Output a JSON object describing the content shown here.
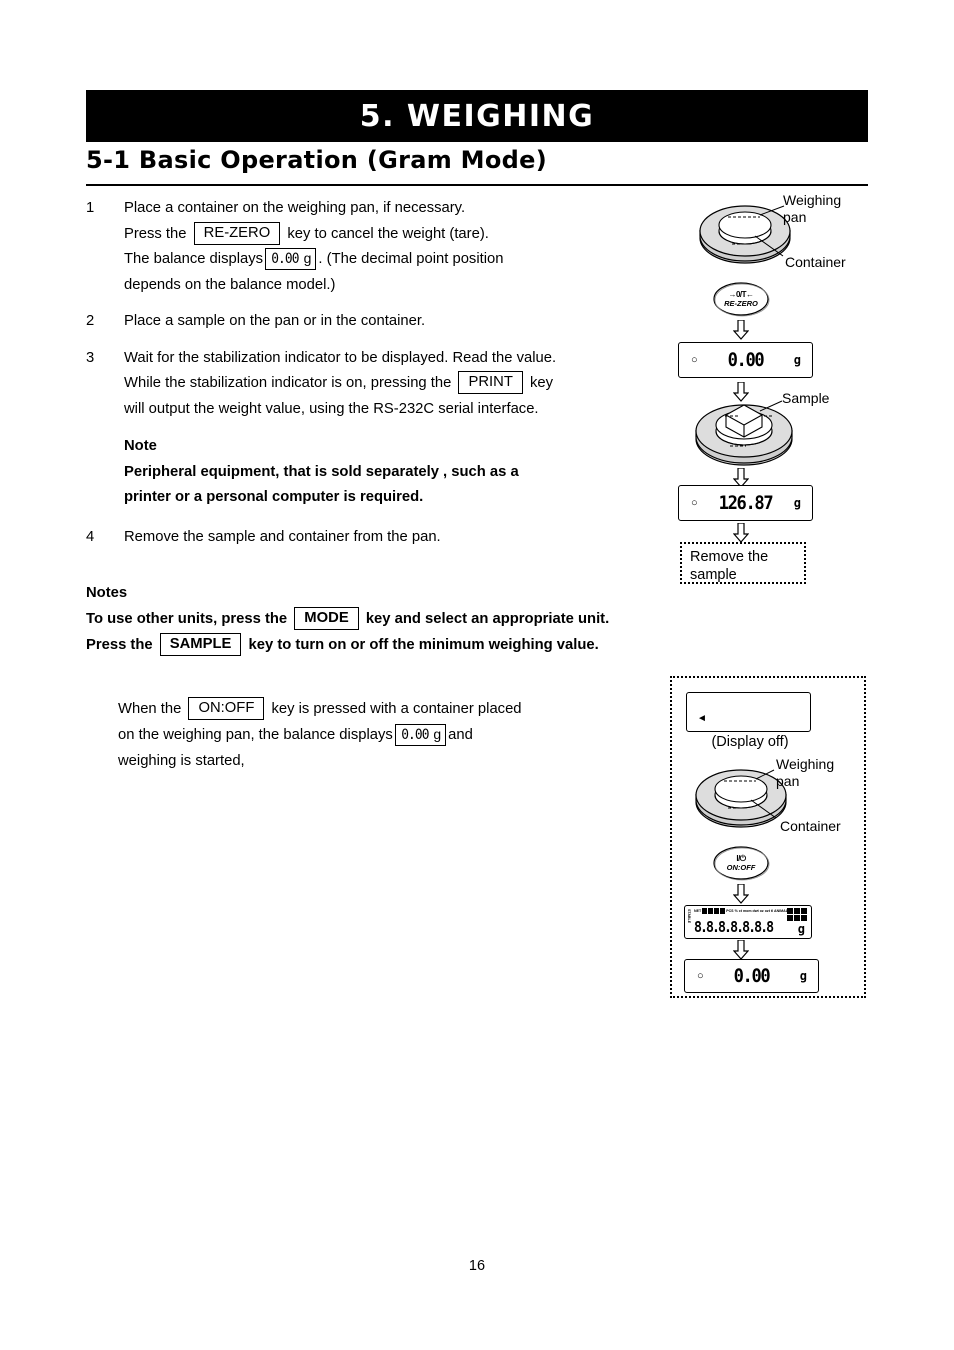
{
  "chapter": {
    "title": "5. WEIGHING",
    "section": "5-1  Basic Operation (Gram Mode)"
  },
  "steps": [
    {
      "num": "1",
      "line1": "Place a container on the weighing pan, if necessary.",
      "line2_a": "Press the",
      "line2_key": "RE-ZERO",
      "line2_b": "key to cancel the weight (tare).",
      "line3_a": "The balance displays",
      "line3_lcd": "0.00",
      "line3_unit": "g",
      "line3_b": ". (The decimal point position",
      "line4": "depends on the balance model.)"
    },
    {
      "num": "2",
      "line1": "Place a sample on the pan or in the container."
    },
    {
      "num": "3",
      "line1": "Wait for the stabilization indicator to be displayed. Read the value.",
      "line2_a": "While the stabilization indicator is on, pressing the",
      "line2_key": "PRINT",
      "line2_b": "key",
      "line3": "will output the weight value, using the RS-232C serial interface."
    },
    {
      "num": "4",
      "line1": "Remove the sample and container from the pan."
    }
  ],
  "note": {
    "heading": "Note",
    "line1": "Peripheral equipment, that is sold separately , such as a",
    "line2": "printer or a personal computer is required."
  },
  "notes": {
    "heading": "Notes",
    "line1_a": "To use other units, press the",
    "line1_key": "MODE",
    "line1_b": "key and select an appropriate unit.",
    "line2_a": "Press the",
    "line2_key": "SAMPLE",
    "line2_b": "key to turn on or off the minimum weighing value."
  },
  "lower": {
    "line1_a": "When the",
    "line1_key": "ON:OFF",
    "line1_b": "key is pressed with a container placed",
    "line2_a": "on the weighing pan, the balance displays",
    "line2_lcd": "0.00",
    "line2_unit": "g",
    "line2_b": "and",
    "line3": "weighing is started,"
  },
  "figure_top": {
    "pan_label": "Weighing\npan",
    "pan_label_line1": "Weighing",
    "pan_label_line2": "pan",
    "container_label": "Container",
    "sample_label": "Sample",
    "rezero_key": {
      "symbol": "→0/T←",
      "label": "RE-ZERO"
    },
    "display_zero": {
      "stabilization": "○",
      "value": "0.00",
      "unit": "g"
    },
    "display_sample": {
      "stabilization": "○",
      "value": "126.87",
      "unit": "g"
    },
    "remove_box_line1": "Remove the",
    "remove_box_line2": "sample"
  },
  "figure_bottom": {
    "display_off_caption": "(Display off)",
    "pan_label_line1": "Weighing",
    "pan_label_line2": "pan",
    "container_label": "Container",
    "onoff_key": {
      "symbol": "I/⏻",
      "label": "ON:OFF"
    },
    "all_segments": {
      "digits": "8.8.8.8.8.8.8",
      "unit": "g",
      "left_indicators": "STABLE",
      "top_indicators": "NET",
      "segment_labels": "PCS % ct mom dwt oz ozt tl ANIMAL"
    },
    "display_zero": {
      "stabilization": "○",
      "value": "0.00",
      "unit": "g"
    }
  },
  "page_number": "16"
}
